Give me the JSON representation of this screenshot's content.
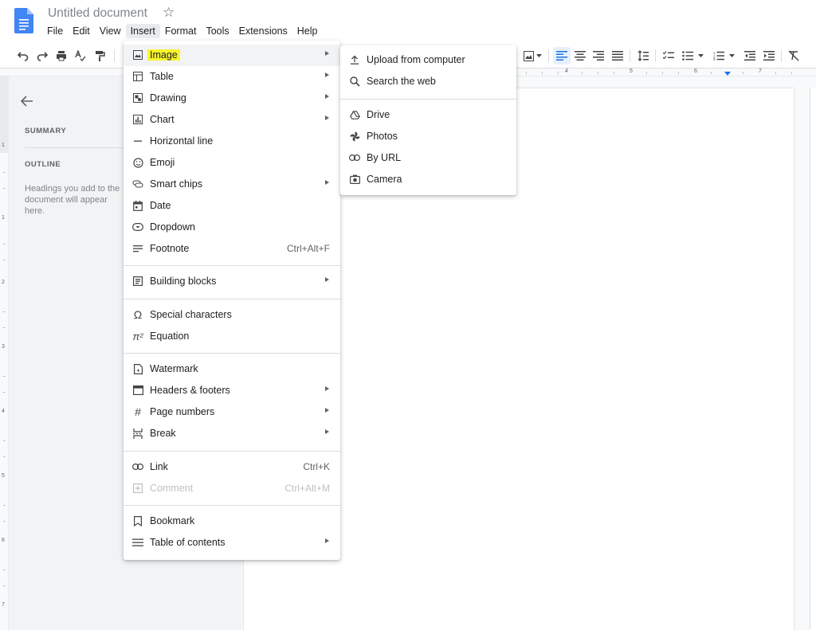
{
  "app": {
    "doc_title": "Untitled document",
    "menus": [
      "File",
      "Edit",
      "View",
      "Insert",
      "Format",
      "Tools",
      "Extensions",
      "Help"
    ],
    "active_menu": "Insert"
  },
  "ruler": {
    "numbers": [
      "4",
      "5",
      "6",
      "7"
    ]
  },
  "vruler": {
    "numbers": [
      "1",
      "1",
      "2",
      "3",
      "4",
      "5",
      "6",
      "7"
    ]
  },
  "outline": {
    "summary": "SUMMARY",
    "outline": "OUTLINE",
    "hint": "Headings you add to the document will appear here."
  },
  "insert_menu": {
    "items": [
      {
        "label": "Image",
        "icon": "image-icon",
        "submenu": true,
        "highlighted": true
      },
      {
        "label": "Table",
        "icon": "table-icon",
        "submenu": true
      },
      {
        "label": "Drawing",
        "icon": "drawing-icon",
        "submenu": true
      },
      {
        "label": "Chart",
        "icon": "chart-icon",
        "submenu": true
      },
      {
        "label": "Horizontal line",
        "icon": "horizontal-line-icon"
      },
      {
        "label": "Emoji",
        "icon": "emoji-icon"
      },
      {
        "label": "Smart chips",
        "icon": "smart-chips-icon",
        "submenu": true
      },
      {
        "label": "Date",
        "icon": "date-icon"
      },
      {
        "label": "Dropdown",
        "icon": "dropdown-icon"
      },
      {
        "label": "Footnote",
        "icon": "footnote-icon",
        "shortcut": "Ctrl+Alt+F"
      },
      {
        "label": "Building blocks",
        "icon": "building-blocks-icon",
        "submenu": true
      },
      {
        "label": "Special characters",
        "icon": "omega-icon"
      },
      {
        "label": "Equation",
        "icon": "pi-icon"
      },
      {
        "label": "Watermark",
        "icon": "watermark-icon"
      },
      {
        "label": "Headers & footers",
        "icon": "headers-footers-icon",
        "submenu": true
      },
      {
        "label": "Page numbers",
        "icon": "hash-icon",
        "submenu": true
      },
      {
        "label": "Break",
        "icon": "break-icon",
        "submenu": true
      },
      {
        "label": "Link",
        "icon": "link-icon",
        "shortcut": "Ctrl+K"
      },
      {
        "label": "Comment",
        "icon": "comment-icon",
        "shortcut": "Ctrl+Alt+M",
        "disabled": true
      },
      {
        "label": "Bookmark",
        "icon": "bookmark-icon"
      },
      {
        "label": "Table of contents",
        "icon": "table-of-contents-icon",
        "submenu": true
      }
    ]
  },
  "image_submenu": {
    "items": [
      {
        "label": "Upload from computer",
        "icon": "upload-icon"
      },
      {
        "label": "Search the web",
        "icon": "search-icon"
      },
      {
        "label": "Drive",
        "icon": "drive-icon"
      },
      {
        "label": "Photos",
        "icon": "photos-icon"
      },
      {
        "label": "By URL",
        "icon": "link-icon"
      },
      {
        "label": "Camera",
        "icon": "camera-icon"
      }
    ]
  },
  "colors": {
    "accent": "#1a73e8",
    "highlight": "#f7f42b",
    "doc_logo": "#4285f4"
  }
}
